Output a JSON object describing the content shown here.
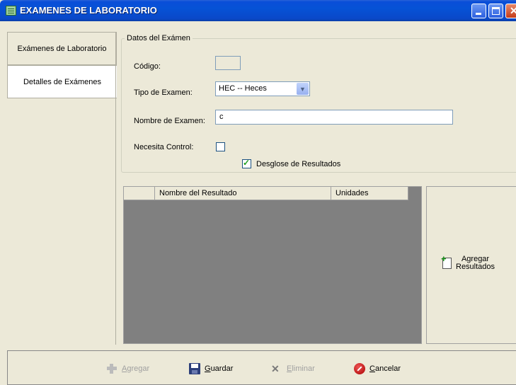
{
  "window": {
    "title": "EXAMENES DE LABORATORIO",
    "icon": "table-icon"
  },
  "tabs": [
    {
      "label": "Exámenes de Laboratorio",
      "selected": false
    },
    {
      "label": "Detalles de Exámenes",
      "selected": true
    }
  ],
  "datos": {
    "legend": "Datos del Exámen",
    "codigo_label": "Código:",
    "codigo_value": "",
    "tipo_label": "Tipo de Examen:",
    "tipo_value": "HEC -- Heces",
    "nombre_label": "Nombre de Examen:",
    "nombre_value": "c",
    "control_label": "Necesita Control:",
    "control_checked": false,
    "desglose_label": "Desglose de Resultados",
    "desglose_checked": true
  },
  "grid": {
    "columns": [
      "",
      "Nombre del Resultado",
      "Unidades"
    ],
    "rows": []
  },
  "add_results": {
    "line1": "Agregar",
    "line2": "Resultados"
  },
  "toolbar": {
    "agregar_first": "A",
    "agregar_rest": "gregar",
    "guardar_first": "G",
    "guardar_rest": "uardar",
    "eliminar_first": "E",
    "eliminar_rest": "liminar",
    "cancelar_first": "C",
    "cancelar_rest": "ancelar"
  }
}
